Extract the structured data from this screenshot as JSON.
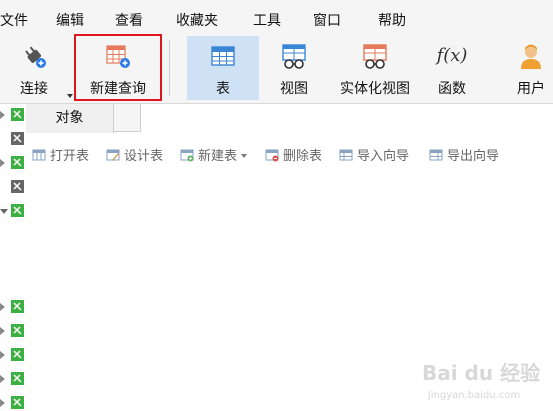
{
  "menubar": {
    "items": [
      {
        "label": "文件"
      },
      {
        "label": "编辑"
      },
      {
        "label": "查看"
      },
      {
        "label": "收藏夹"
      },
      {
        "label": "工具"
      },
      {
        "label": "窗口"
      },
      {
        "label": "帮助"
      }
    ]
  },
  "ribbon": {
    "connect_label": "连接",
    "new_query_label": "新建查询",
    "table_label": "表",
    "view_label": "视图",
    "materialized_view_label": "实体化视图",
    "function_label": "函数",
    "user_label": "用户",
    "function_icon_text": "f(x)"
  },
  "tabs": {
    "objects_label": "对象"
  },
  "object_toolbar": {
    "open_table": "打开表",
    "design_table": "设计表",
    "new_table": "新建表",
    "delete_table": "删除表",
    "import_wizard": "导入向导",
    "export_wizard": "导出向导"
  },
  "colors": {
    "accent_active": "#cfe1f5",
    "highlight_red": "#e0141e",
    "db_green": "#3cb043"
  },
  "watermark": {
    "text": "Bai du 经验",
    "url": "jingyan.baidu.com"
  }
}
